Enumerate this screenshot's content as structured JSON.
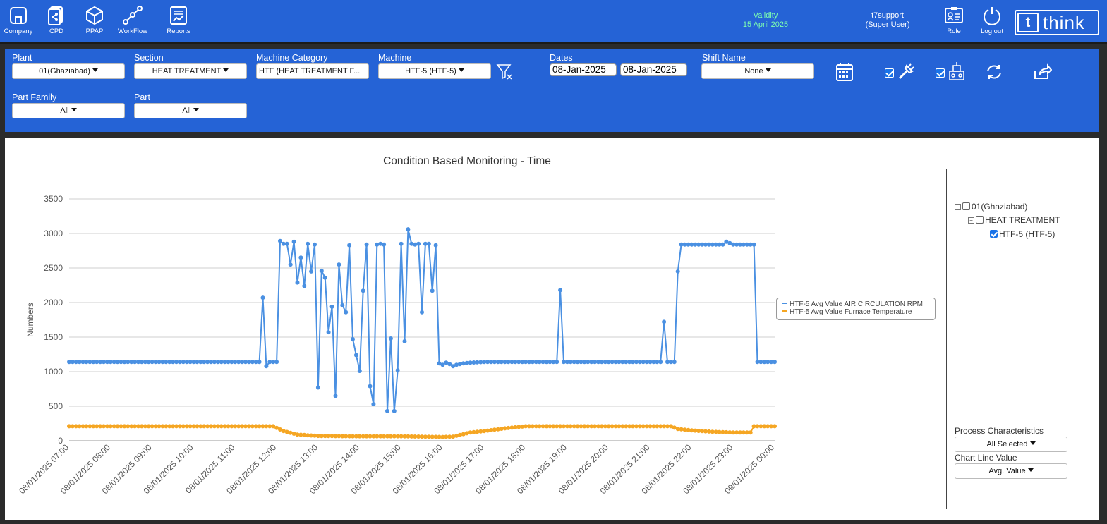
{
  "nav": [
    {
      "label": "Company",
      "icon": "company-icon"
    },
    {
      "label": "CPD",
      "icon": "cpd-icon"
    },
    {
      "label": "PPAP",
      "icon": "ppap-icon"
    },
    {
      "label": "WorkFlow",
      "icon": "workflow-icon"
    },
    {
      "label": "Reports",
      "icon": "reports-icon"
    }
  ],
  "validity": {
    "label": "Validity",
    "date": "15 April 2025"
  },
  "user": {
    "name": "t7support",
    "role": "(Super User)"
  },
  "actions": {
    "role_label": "Role",
    "logout_label": "Log out"
  },
  "logo": {
    "mark": "t",
    "word": "think"
  },
  "colors": {
    "brand": "#2563d6",
    "series1": "#4a90e2",
    "series2": "#f5a623",
    "validity": "#7dffb0"
  },
  "filters": {
    "plant": {
      "label": "Plant",
      "value": "01(Ghaziabad)"
    },
    "section": {
      "label": "Section",
      "value": "HEAT TREATMENT"
    },
    "machine_category": {
      "label": "Machine Category",
      "value": "HTF (HEAT TREATMENT F..."
    },
    "machine": {
      "label": "Machine",
      "value": "HTF-5 (HTF-5)"
    },
    "dates": {
      "label": "Dates",
      "from": "08-Jan-2025",
      "to": "08-Jan-2025"
    },
    "shift": {
      "label": "Shift Name",
      "value": "None"
    },
    "part_family": {
      "label": "Part Family",
      "value": "All"
    },
    "part": {
      "label": "Part",
      "value": "All"
    },
    "toggle1_checked": true,
    "toggle2_checked": true
  },
  "tree": {
    "plant": {
      "label": "01(Ghaziabad)",
      "checked": false
    },
    "section": {
      "label": "HEAT TREATMENT",
      "checked": false
    },
    "machine": {
      "label": "HTF-5 (HTF-5)",
      "checked": true
    }
  },
  "side": {
    "process_label": "Process Characteristics",
    "process_value": "All Selected",
    "chart_line_label": "Chart Line Value",
    "chart_line_value": "Avg. Value"
  },
  "chart_data": {
    "type": "line",
    "title": "Condition Based Monitoring - Time",
    "ylabel": "Numbers",
    "xlabel": "",
    "ylim": [
      0,
      3500
    ],
    "yticks": [
      0,
      500,
      1000,
      1500,
      2000,
      2500,
      3000,
      3500
    ],
    "xlim": [
      "08/01/2025 07:00",
      "09/01/2025 00:00"
    ],
    "xtick_labels": [
      "08/01/2025 07:00",
      "08/01/2025 08:00",
      "08/01/2025 09:00",
      "08/01/2025 10:00",
      "08/01/2025 11:00",
      "08/01/2025 12:00",
      "08/01/2025 13:00",
      "08/01/2025 14:00",
      "08/01/2025 15:00",
      "08/01/2025 16:00",
      "08/01/2025 17:00",
      "08/01/2025 18:00",
      "08/01/2025 19:00",
      "08/01/2025 20:00",
      "08/01/2025 21:00",
      "08/01/2025 22:00",
      "08/01/2025 23:00",
      "09/01/2025 00:00"
    ],
    "grid": true,
    "legend_position": "right",
    "series": [
      {
        "name": "HTF-5 Avg Value AIR CIRCULATION RPM",
        "color": "#4a90e2",
        "x": [
          "08/01/2025 07:00",
          "08/01/2025 11:35",
          "08/01/2025 11:40",
          "08/01/2025 11:45",
          "08/01/2025 11:50",
          "08/01/2025 11:55",
          "08/01/2025 12:00",
          "08/01/2025 12:05",
          "08/01/2025 12:10",
          "08/01/2025 12:15",
          "08/01/2025 12:20",
          "08/01/2025 12:25",
          "08/01/2025 12:30",
          "08/01/2025 12:35",
          "08/01/2025 12:40",
          "08/01/2025 12:45",
          "08/01/2025 12:50",
          "08/01/2025 12:55",
          "08/01/2025 13:00",
          "08/01/2025 13:05",
          "08/01/2025 13:10",
          "08/01/2025 13:15",
          "08/01/2025 13:20",
          "08/01/2025 13:25",
          "08/01/2025 13:30",
          "08/01/2025 13:35",
          "08/01/2025 13:40",
          "08/01/2025 13:45",
          "08/01/2025 13:50",
          "08/01/2025 14:00",
          "08/01/2025 14:05",
          "08/01/2025 14:10",
          "08/01/2025 14:15",
          "08/01/2025 14:20",
          "08/01/2025 14:25",
          "08/01/2025 14:30",
          "08/01/2025 14:35",
          "08/01/2025 14:40",
          "08/01/2025 14:45",
          "08/01/2025 14:50",
          "08/01/2025 14:55",
          "08/01/2025 15:00",
          "08/01/2025 15:05",
          "08/01/2025 15:10",
          "08/01/2025 15:15",
          "08/01/2025 15:20",
          "08/01/2025 15:25",
          "08/01/2025 15:30",
          "08/01/2025 15:35",
          "08/01/2025 15:40",
          "08/01/2025 15:45",
          "08/01/2025 15:50",
          "08/01/2025 15:55",
          "08/01/2025 16:00",
          "08/01/2025 16:05",
          "08/01/2025 16:10",
          "08/01/2025 16:15",
          "08/01/2025 16:20",
          "08/01/2025 16:30",
          "08/01/2025 16:40",
          "08/01/2025 17:00",
          "08/01/2025 18:00",
          "08/01/2025 18:45",
          "08/01/2025 18:50",
          "08/01/2025 18:55",
          "08/01/2025 19:00",
          "08/01/2025 20:00",
          "08/01/2025 21:00",
          "08/01/2025 21:10",
          "08/01/2025 21:15",
          "08/01/2025 21:20",
          "08/01/2025 21:25",
          "08/01/2025 21:30",
          "08/01/2025 21:35",
          "08/01/2025 21:40",
          "08/01/2025 21:45",
          "08/01/2025 22:00",
          "08/01/2025 22:45",
          "08/01/2025 22:50",
          "08/01/2025 23:00",
          "08/01/2025 23:30",
          "08/01/2025 23:35",
          "08/01/2025 23:40",
          "09/01/2025 00:00"
        ],
        "values": [
          1140,
          1140,
          2070,
          1080,
          1140,
          1140,
          1140,
          2890,
          2850,
          2850,
          2550,
          2880,
          2290,
          2650,
          2240,
          2850,
          2450,
          2840,
          770,
          2460,
          2360,
          1570,
          1940,
          650,
          2550,
          1960,
          1860,
          2830,
          1470,
          1010,
          2170,
          2840,
          790,
          530,
          2840,
          2850,
          2840,
          430,
          1480,
          430,
          1020,
          2850,
          1440,
          3060,
          2850,
          2840,
          2850,
          1860,
          2850,
          2850,
          2170,
          2830,
          1120,
          1100,
          1130,
          1110,
          1080,
          1100,
          1120,
          1130,
          1140,
          1140,
          1140,
          2180,
          1140,
          1140,
          1140,
          1140,
          1140,
          1140,
          1720,
          1140,
          1140,
          1140,
          2450,
          2840,
          2840,
          2840,
          2880,
          2840,
          2840,
          1140,
          1140,
          1140
        ]
      },
      {
        "name": "HTF-5 Avg Value Furnace Temperature",
        "color": "#f5a623",
        "x": [
          "08/01/2025 07:00",
          "08/01/2025 11:55",
          "08/01/2025 12:10",
          "08/01/2025 12:30",
          "08/01/2025 13:00",
          "08/01/2025 13:50",
          "08/01/2025 14:10",
          "08/01/2025 15:00",
          "08/01/2025 16:00",
          "08/01/2025 16:15",
          "08/01/2025 16:40",
          "08/01/2025 17:00",
          "08/01/2025 17:30",
          "08/01/2025 18:00",
          "08/01/2025 21:30",
          "08/01/2025 21:40",
          "08/01/2025 22:00",
          "08/01/2025 22:30",
          "08/01/2025 23:00",
          "08/01/2025 23:25",
          "08/01/2025 23:30",
          "09/01/2025 00:00"
        ],
        "values": [
          210,
          210,
          140,
          90,
          70,
          65,
          65,
          65,
          55,
          60,
          120,
          140,
          180,
          210,
          210,
          170,
          150,
          130,
          120,
          120,
          210,
          210
        ]
      }
    ]
  }
}
